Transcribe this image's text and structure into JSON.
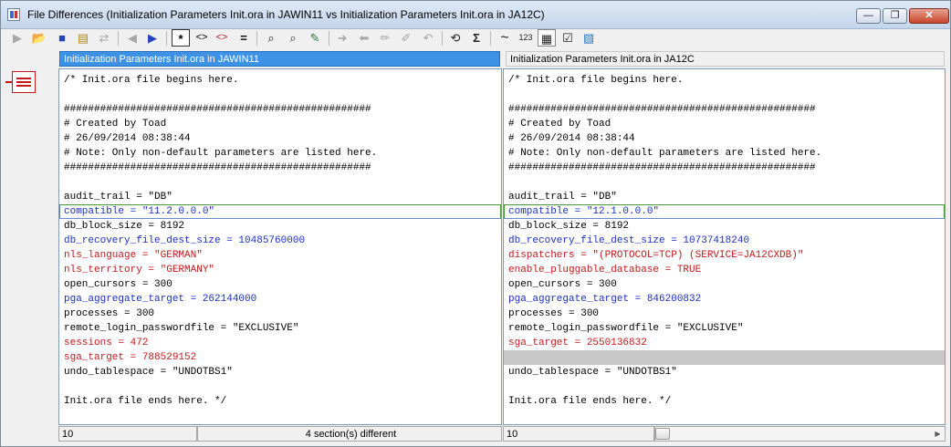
{
  "window": {
    "title": "File Differences (Initialization Parameters Init.ora in JAWIN11 vs Initialization Parameters Init.ora in JA12C)",
    "minimize": "—",
    "restore": "❐",
    "close": "✕"
  },
  "toolbar": {
    "icons": [
      "play-icon",
      "open-folder-icon",
      "save-icon",
      "copy-icon",
      "swap-icon",
      "previous-arrow-icon",
      "next-arrow-icon",
      "asterisk-filter-icon",
      "show-differences-icon",
      "show-changes-icon",
      "equals-icon",
      "binoculars-icon",
      "find-next-icon",
      "highlight-icon",
      "forward-arrow-icon",
      "back-arrow-icon",
      "edit-icon",
      "edit-alt-icon",
      "undo-icon",
      "sync-icon",
      "sigma-icon",
      "tilde-icon",
      "line-numbers-icon",
      "clipboard-icon",
      "checklist-icon",
      "report-icon"
    ],
    "glyphs": {
      "play": "▶",
      "open": "📂",
      "save": "■",
      "copy": "▤",
      "swap": "⇄",
      "prev": "◀",
      "next": "▶",
      "asterisk": "*",
      "diff": "<>",
      "change": "<>",
      "equals": "=",
      "find": "⌕",
      "find_next": "⌕",
      "highlight": "✎",
      "fwd": "➜",
      "back": "⬅",
      "edit": "✏",
      "edit2": "✐",
      "undo": "↶",
      "sync": "⟲",
      "sigma": "Σ",
      "tilde": "~",
      "numbers": "123",
      "view": "▦",
      "check": "☑",
      "report": "▧"
    }
  },
  "left": {
    "header": "Initialization Parameters Init.ora in JAWIN11",
    "lines": [
      {
        "text": "/* Init.ora file begins here.",
        "type": "normal"
      },
      {
        "text": "",
        "type": "normal"
      },
      {
        "text": "###################################################",
        "type": "normal"
      },
      {
        "text": "# Created by Toad",
        "type": "normal"
      },
      {
        "text": "# 26/09/2014 08:38:44",
        "type": "normal"
      },
      {
        "text": "# Note: Only non-default parameters are listed here.",
        "type": "normal"
      },
      {
        "text": "###################################################",
        "type": "normal"
      },
      {
        "text": "",
        "type": "normal"
      },
      {
        "text": "audit_trail = \"DB\"",
        "type": "normal"
      },
      {
        "text": "compatible = \"11.2.0.0.0\"",
        "type": "mod focus"
      },
      {
        "text": "db_block_size = 8192",
        "type": "normal"
      },
      {
        "text": "db_recovery_file_dest_size = 10485760000",
        "type": "mod"
      },
      {
        "text": "nls_language = \"GERMAN\"",
        "type": "del"
      },
      {
        "text": "nls_territory = \"GERMANY\"",
        "type": "del"
      },
      {
        "text": "open_cursors = 300",
        "type": "normal"
      },
      {
        "text": "pga_aggregate_target = 262144000",
        "type": "mod"
      },
      {
        "text": "processes = 300",
        "type": "normal"
      },
      {
        "text": "remote_login_passwordfile = \"EXCLUSIVE\"",
        "type": "normal"
      },
      {
        "text": "sessions = 472",
        "type": "del"
      },
      {
        "text": "sga_target = 788529152",
        "type": "del"
      },
      {
        "text": "undo_tablespace = \"UNDOTBS1\"",
        "type": "normal"
      },
      {
        "text": "",
        "type": "normal"
      },
      {
        "text": "Init.ora file ends here. */",
        "type": "normal"
      }
    ],
    "status_line": "10",
    "status_message": "4 section(s) different"
  },
  "right": {
    "header": "Initialization Parameters Init.ora in JA12C",
    "lines": [
      {
        "text": "/* Init.ora file begins here.",
        "type": "normal"
      },
      {
        "text": "",
        "type": "normal"
      },
      {
        "text": "###################################################",
        "type": "normal"
      },
      {
        "text": "# Created by Toad",
        "type": "normal"
      },
      {
        "text": "# 26/09/2014 08:38:44",
        "type": "normal"
      },
      {
        "text": "# Note: Only non-default parameters are listed here.",
        "type": "normal"
      },
      {
        "text": "###################################################",
        "type": "normal"
      },
      {
        "text": "",
        "type": "normal"
      },
      {
        "text": "audit_trail = \"DB\"",
        "type": "normal"
      },
      {
        "text": "compatible = \"12.1.0.0.0\"",
        "type": "mod focus"
      },
      {
        "text": "db_block_size = 8192",
        "type": "normal"
      },
      {
        "text": "db_recovery_file_dest_size = 10737418240",
        "type": "mod"
      },
      {
        "text": "dispatchers = \"(PROTOCOL=TCP) (SERVICE=JA12CXDB)\"",
        "type": "del"
      },
      {
        "text": "enable_pluggable_database = TRUE",
        "type": "del"
      },
      {
        "text": "open_cursors = 300",
        "type": "normal"
      },
      {
        "text": "pga_aggregate_target = 846200832",
        "type": "mod"
      },
      {
        "text": "processes = 300",
        "type": "normal"
      },
      {
        "text": "remote_login_passwordfile = \"EXCLUSIVE\"",
        "type": "normal"
      },
      {
        "text": "sga_target = 2550136832",
        "type": "del"
      },
      {
        "text": "",
        "type": "blank"
      },
      {
        "text": "undo_tablespace = \"UNDOTBS1\"",
        "type": "normal"
      },
      {
        "text": "",
        "type": "normal"
      },
      {
        "text": "Init.ora file ends here. */",
        "type": "normal"
      }
    ],
    "status_line": "10"
  },
  "scrollbar": {
    "left_arrow": "◀",
    "right_arrow": "▶"
  },
  "colors": {
    "modified": "#1a30c2",
    "deleted": "#c21a1a",
    "blank_fill": "#c8c8c8",
    "active_header": "#3d92e6"
  }
}
